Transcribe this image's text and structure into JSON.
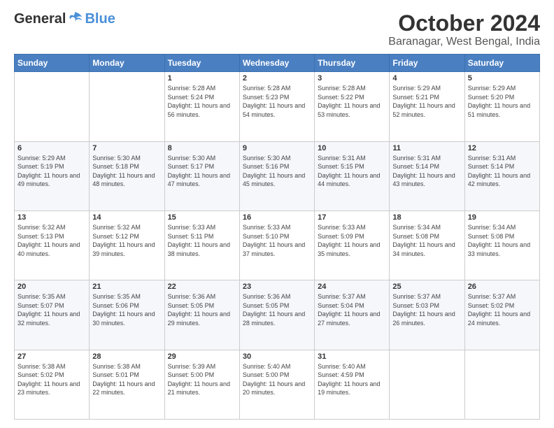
{
  "logo": {
    "general": "General",
    "blue": "Blue"
  },
  "header": {
    "month": "October 2024",
    "location": "Baranagar, West Bengal, India"
  },
  "weekdays": [
    "Sunday",
    "Monday",
    "Tuesday",
    "Wednesday",
    "Thursday",
    "Friday",
    "Saturday"
  ],
  "weeks": [
    [
      {
        "day": "",
        "info": ""
      },
      {
        "day": "",
        "info": ""
      },
      {
        "day": "1",
        "info": "Sunrise: 5:28 AM\nSunset: 5:24 PM\nDaylight: 11 hours and 56 minutes."
      },
      {
        "day": "2",
        "info": "Sunrise: 5:28 AM\nSunset: 5:23 PM\nDaylight: 11 hours and 54 minutes."
      },
      {
        "day": "3",
        "info": "Sunrise: 5:28 AM\nSunset: 5:22 PM\nDaylight: 11 hours and 53 minutes."
      },
      {
        "day": "4",
        "info": "Sunrise: 5:29 AM\nSunset: 5:21 PM\nDaylight: 11 hours and 52 minutes."
      },
      {
        "day": "5",
        "info": "Sunrise: 5:29 AM\nSunset: 5:20 PM\nDaylight: 11 hours and 51 minutes."
      }
    ],
    [
      {
        "day": "6",
        "info": "Sunrise: 5:29 AM\nSunset: 5:19 PM\nDaylight: 11 hours and 49 minutes."
      },
      {
        "day": "7",
        "info": "Sunrise: 5:30 AM\nSunset: 5:18 PM\nDaylight: 11 hours and 48 minutes."
      },
      {
        "day": "8",
        "info": "Sunrise: 5:30 AM\nSunset: 5:17 PM\nDaylight: 11 hours and 47 minutes."
      },
      {
        "day": "9",
        "info": "Sunrise: 5:30 AM\nSunset: 5:16 PM\nDaylight: 11 hours and 45 minutes."
      },
      {
        "day": "10",
        "info": "Sunrise: 5:31 AM\nSunset: 5:15 PM\nDaylight: 11 hours and 44 minutes."
      },
      {
        "day": "11",
        "info": "Sunrise: 5:31 AM\nSunset: 5:14 PM\nDaylight: 11 hours and 43 minutes."
      },
      {
        "day": "12",
        "info": "Sunrise: 5:31 AM\nSunset: 5:14 PM\nDaylight: 11 hours and 42 minutes."
      }
    ],
    [
      {
        "day": "13",
        "info": "Sunrise: 5:32 AM\nSunset: 5:13 PM\nDaylight: 11 hours and 40 minutes."
      },
      {
        "day": "14",
        "info": "Sunrise: 5:32 AM\nSunset: 5:12 PM\nDaylight: 11 hours and 39 minutes."
      },
      {
        "day": "15",
        "info": "Sunrise: 5:33 AM\nSunset: 5:11 PM\nDaylight: 11 hours and 38 minutes."
      },
      {
        "day": "16",
        "info": "Sunrise: 5:33 AM\nSunset: 5:10 PM\nDaylight: 11 hours and 37 minutes."
      },
      {
        "day": "17",
        "info": "Sunrise: 5:33 AM\nSunset: 5:09 PM\nDaylight: 11 hours and 35 minutes."
      },
      {
        "day": "18",
        "info": "Sunrise: 5:34 AM\nSunset: 5:08 PM\nDaylight: 11 hours and 34 minutes."
      },
      {
        "day": "19",
        "info": "Sunrise: 5:34 AM\nSunset: 5:08 PM\nDaylight: 11 hours and 33 minutes."
      }
    ],
    [
      {
        "day": "20",
        "info": "Sunrise: 5:35 AM\nSunset: 5:07 PM\nDaylight: 11 hours and 32 minutes."
      },
      {
        "day": "21",
        "info": "Sunrise: 5:35 AM\nSunset: 5:06 PM\nDaylight: 11 hours and 30 minutes."
      },
      {
        "day": "22",
        "info": "Sunrise: 5:36 AM\nSunset: 5:05 PM\nDaylight: 11 hours and 29 minutes."
      },
      {
        "day": "23",
        "info": "Sunrise: 5:36 AM\nSunset: 5:05 PM\nDaylight: 11 hours and 28 minutes."
      },
      {
        "day": "24",
        "info": "Sunrise: 5:37 AM\nSunset: 5:04 PM\nDaylight: 11 hours and 27 minutes."
      },
      {
        "day": "25",
        "info": "Sunrise: 5:37 AM\nSunset: 5:03 PM\nDaylight: 11 hours and 26 minutes."
      },
      {
        "day": "26",
        "info": "Sunrise: 5:37 AM\nSunset: 5:02 PM\nDaylight: 11 hours and 24 minutes."
      }
    ],
    [
      {
        "day": "27",
        "info": "Sunrise: 5:38 AM\nSunset: 5:02 PM\nDaylight: 11 hours and 23 minutes."
      },
      {
        "day": "28",
        "info": "Sunrise: 5:38 AM\nSunset: 5:01 PM\nDaylight: 11 hours and 22 minutes."
      },
      {
        "day": "29",
        "info": "Sunrise: 5:39 AM\nSunset: 5:00 PM\nDaylight: 11 hours and 21 minutes."
      },
      {
        "day": "30",
        "info": "Sunrise: 5:40 AM\nSunset: 5:00 PM\nDaylight: 11 hours and 20 minutes."
      },
      {
        "day": "31",
        "info": "Sunrise: 5:40 AM\nSunset: 4:59 PM\nDaylight: 11 hours and 19 minutes."
      },
      {
        "day": "",
        "info": ""
      },
      {
        "day": "",
        "info": ""
      }
    ]
  ]
}
